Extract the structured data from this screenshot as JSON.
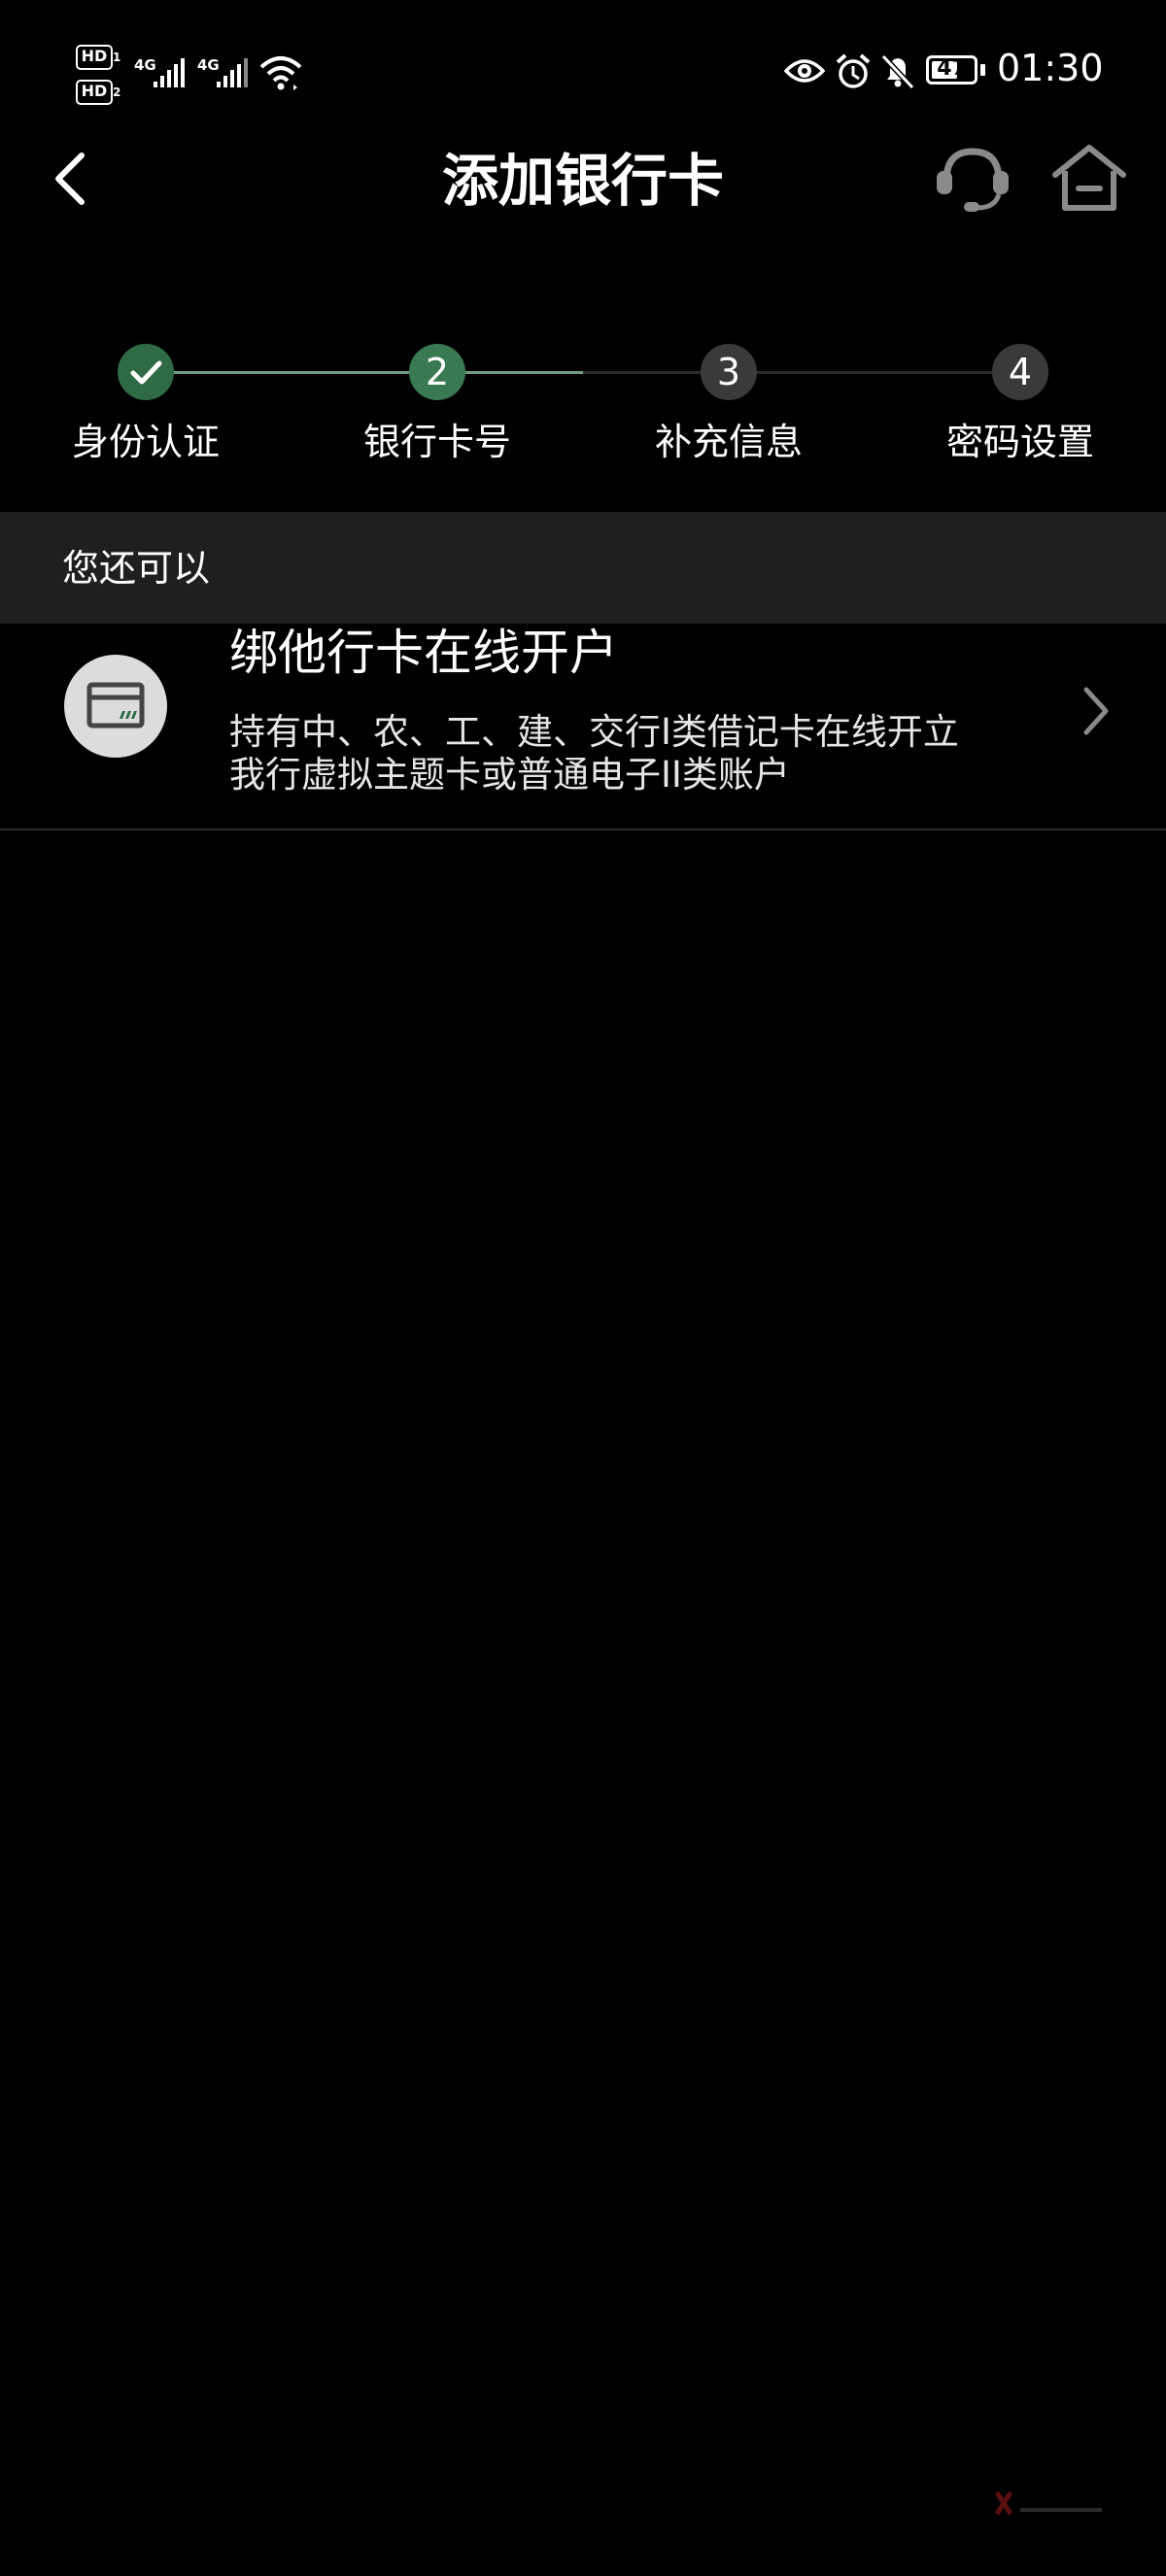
{
  "status_bar": {
    "sim1_badge": "HD",
    "sim1_index": "1",
    "sim2_badge": "HD",
    "sim2_index": "2",
    "network1": "4G",
    "network2": "4G",
    "battery_level": "47",
    "time": "01:30"
  },
  "header": {
    "title": "添加银行卡"
  },
  "steps": [
    {
      "label": "身份认证",
      "number": "",
      "status": "done"
    },
    {
      "label": "银行卡号",
      "number": "2",
      "status": "active"
    },
    {
      "label": "补充信息",
      "number": "3",
      "status": "pending"
    },
    {
      "label": "密码设置",
      "number": "4",
      "status": "pending"
    }
  ],
  "section": {
    "header": "您还可以"
  },
  "option": {
    "title": "绑他行卡在线开户",
    "description_line1": "持有中、农、工、建、交行I类借记卡在线开立",
    "description_line2": "我行虚拟主题卡或普通电子II类账户",
    "icon": "bank-card-icon"
  },
  "colors": {
    "background": "#000000",
    "step_done": "#2e6b45",
    "step_active": "#3a7a52",
    "step_pending": "#3a3a3a",
    "progress_line_done": "#6e9a80",
    "progress_line_pending": "#2b2b2b",
    "section_bg": "#1f1f1f",
    "icon_circle": "#dcdcdc",
    "icon_accent": "#2e6b45"
  }
}
